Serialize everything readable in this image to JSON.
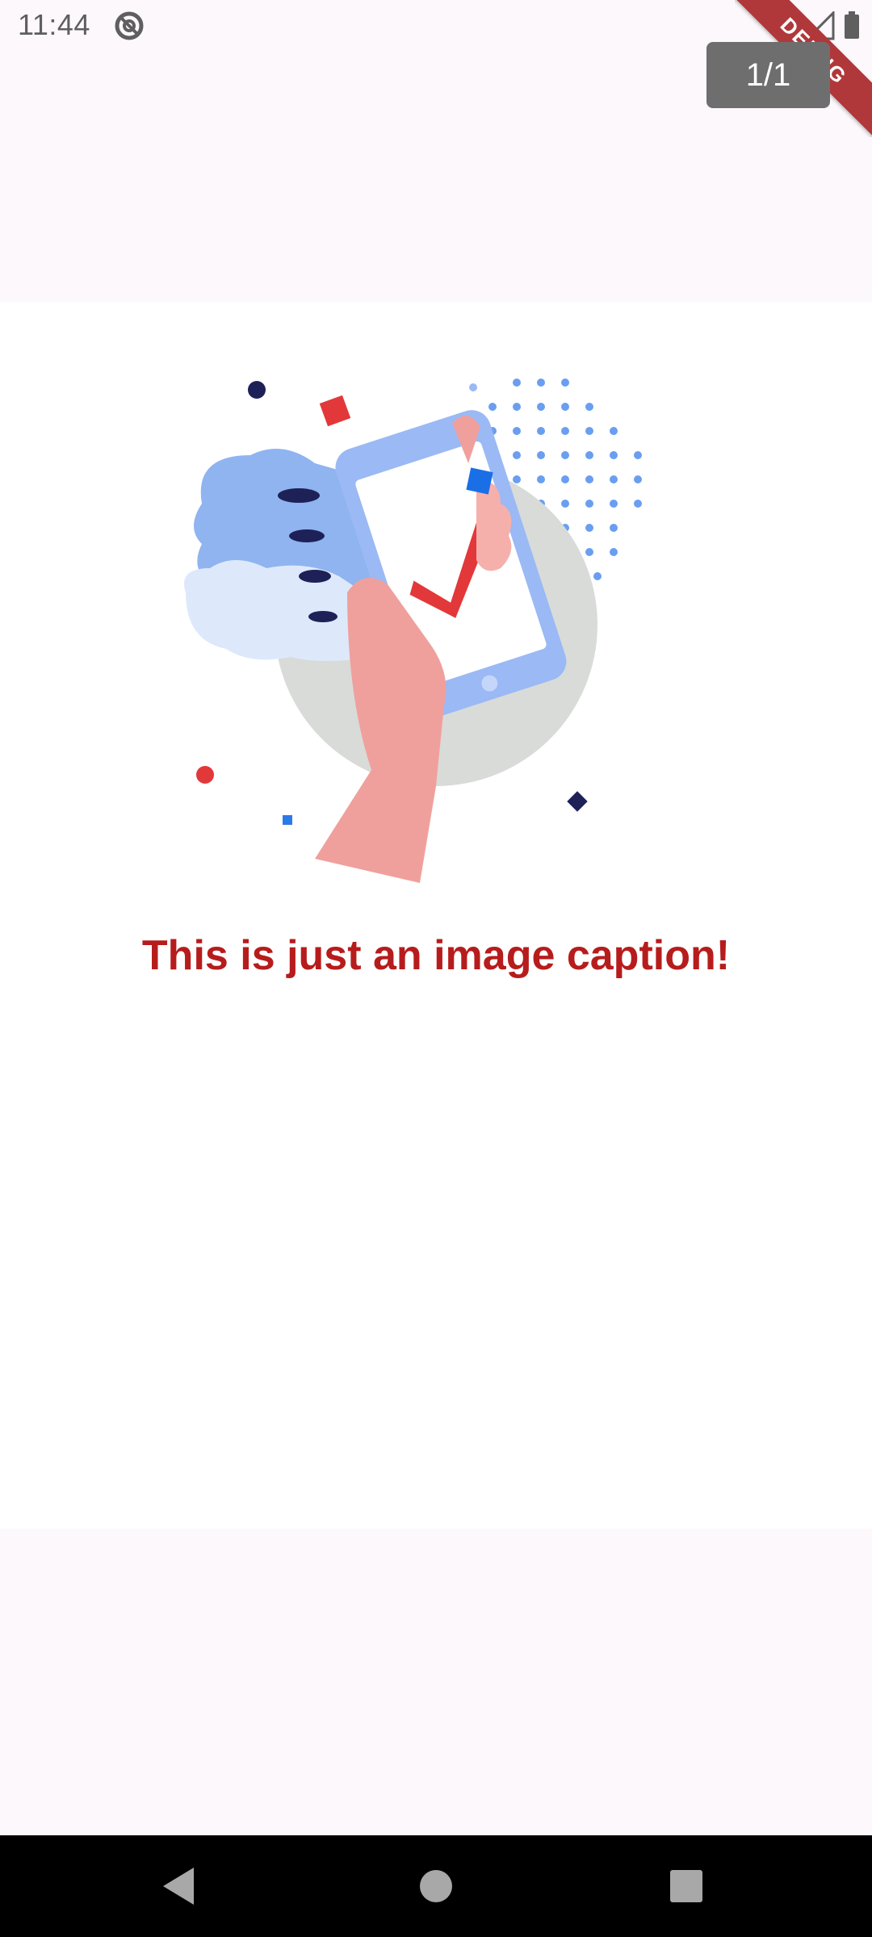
{
  "status_bar": {
    "time": "11:44"
  },
  "debug_banner": {
    "label": "DEBUG"
  },
  "gallery": {
    "page_counter": "1/1"
  },
  "image": {
    "caption": "This is just an image caption!"
  },
  "colors": {
    "caption": "#b71c1c",
    "counter_bg": "#6e6e6e",
    "banner": "#b0383a"
  },
  "icons": [
    "sync-disabled-icon",
    "wifi-icon",
    "signal-icon",
    "battery-icon",
    "back-icon",
    "home-icon",
    "recents-icon"
  ]
}
